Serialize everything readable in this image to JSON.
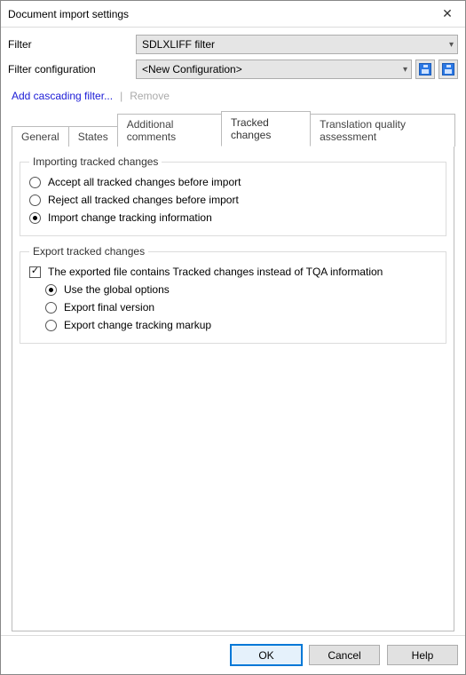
{
  "window": {
    "title": "Document import settings"
  },
  "filter": {
    "label": "Filter",
    "value": "SDLXLIFF filter"
  },
  "filter_config": {
    "label": "Filter configuration",
    "value": "<New Configuration>"
  },
  "links": {
    "add_cascading": "Add cascading filter...",
    "remove": "Remove"
  },
  "tabs": {
    "general": "General",
    "states": "States",
    "additional_comments": "Additional comments",
    "tracked_changes": "Tracked changes",
    "tqa": "Translation quality assessment"
  },
  "importing": {
    "legend": "Importing tracked changes",
    "accept_all": "Accept all tracked changes before import",
    "reject_all": "Reject all tracked changes before import",
    "import_info": "Import change tracking information"
  },
  "exporting": {
    "legend": "Export tracked changes",
    "contains_tqa": "The exported file contains Tracked changes instead of TQA information",
    "use_global": "Use the global options",
    "final": "Export final version",
    "markup": "Export change tracking markup"
  },
  "buttons": {
    "ok": "OK",
    "cancel": "Cancel",
    "help": "Help"
  }
}
